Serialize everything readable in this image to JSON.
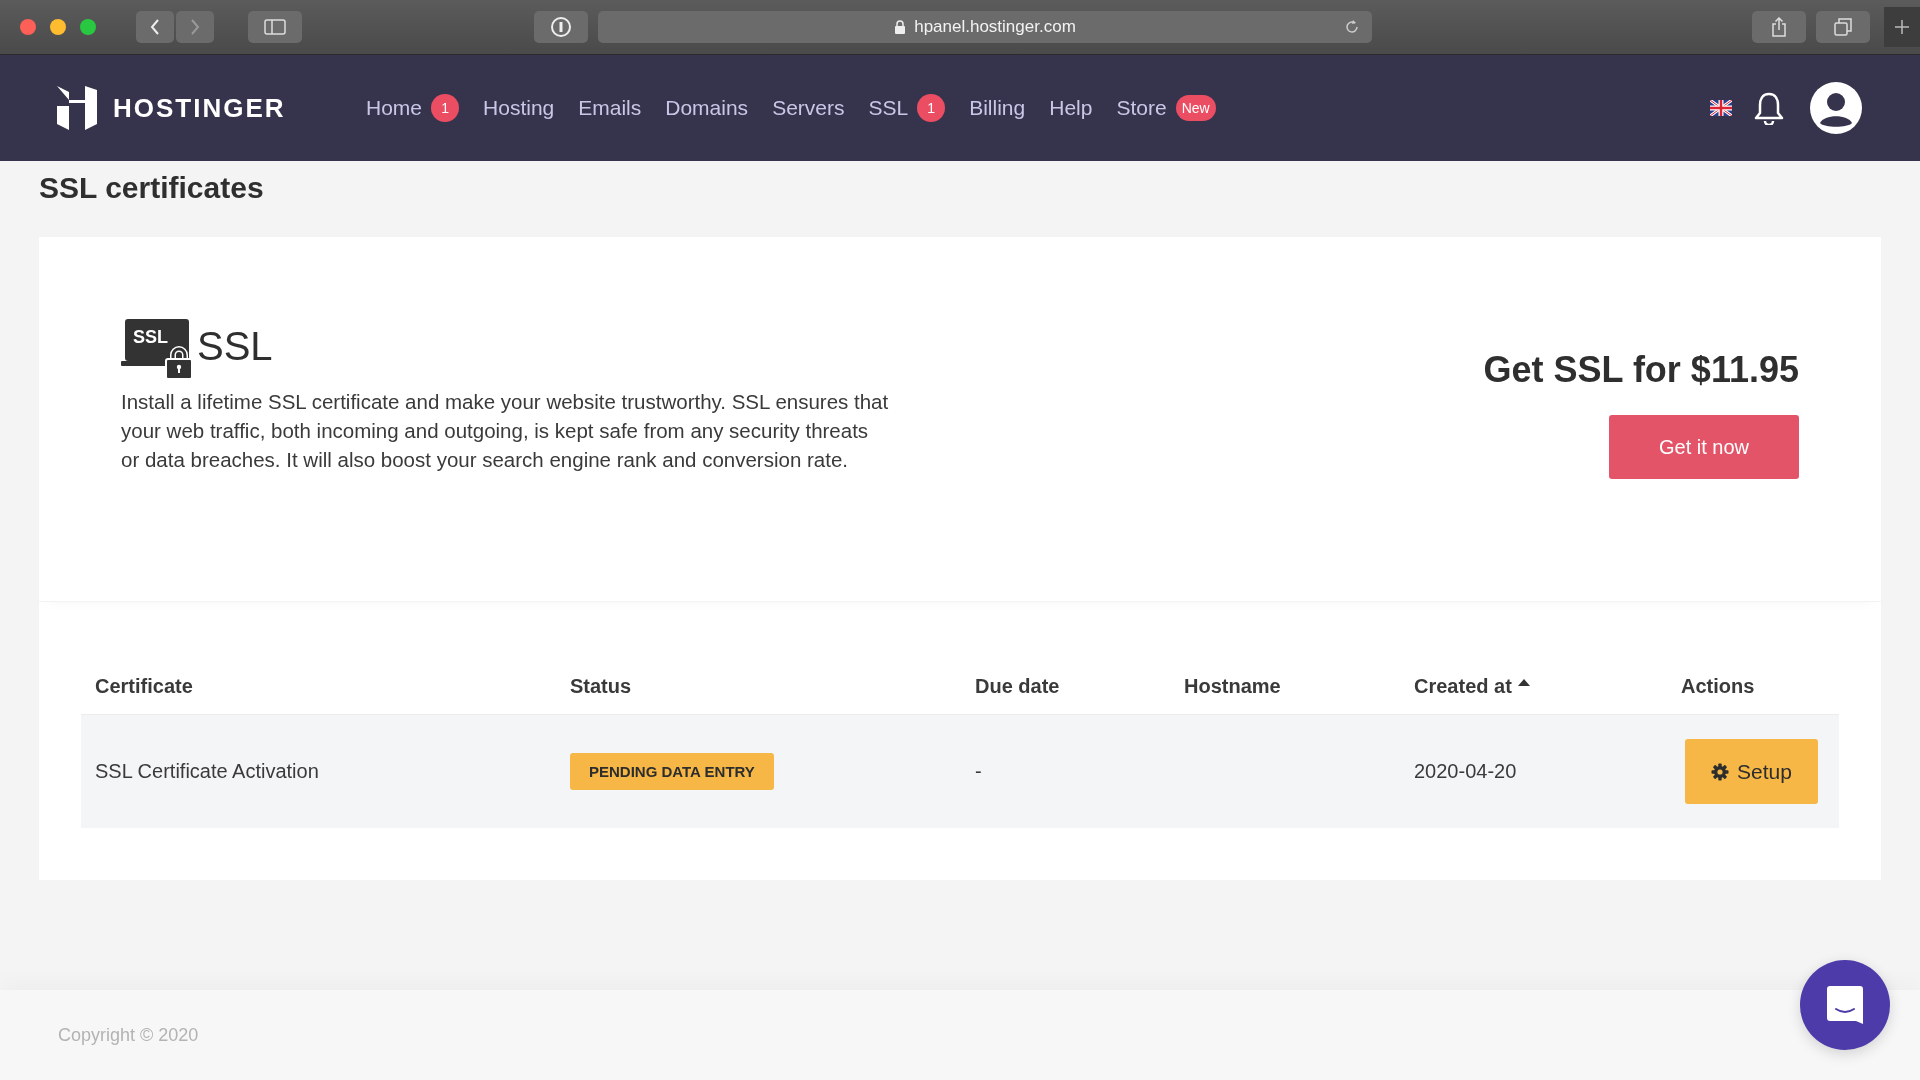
{
  "browser": {
    "url": "hpanel.hostinger.com"
  },
  "header": {
    "brand": "HOSTINGER",
    "nav": [
      {
        "label": "Home",
        "badge": "1"
      },
      {
        "label": "Hosting"
      },
      {
        "label": "Emails"
      },
      {
        "label": "Domains"
      },
      {
        "label": "Servers"
      },
      {
        "label": "SSL",
        "badge": "1"
      },
      {
        "label": "Billing"
      },
      {
        "label": "Help"
      },
      {
        "label": "Store",
        "badge": "New"
      }
    ]
  },
  "page_title": "SSL certificates",
  "promo": {
    "logo_badge": "SSL",
    "logo_text": "SSL",
    "description": "Install a lifetime SSL certificate and make your website trustworthy. SSL ensures that your web traffic, both incoming and outgoing, is kept safe from any security threats or data breaches. It will also boost your search engine rank and conversion rate.",
    "price_heading": "Get SSL for $11.95",
    "button": "Get it now"
  },
  "table": {
    "columns": [
      {
        "label": "Certificate",
        "sorted": false
      },
      {
        "label": "Status",
        "sorted": false
      },
      {
        "label": "Due date",
        "sorted": false
      },
      {
        "label": "Hostname",
        "sorted": false
      },
      {
        "label": "Created at",
        "sorted": true
      },
      {
        "label": "Actions",
        "sorted": false
      }
    ],
    "rows": [
      {
        "certificate": "SSL Certificate Activation",
        "status": "PENDING DATA ENTRY",
        "due_date": "-",
        "created_at": "2020-04-20",
        "action": "Setup"
      }
    ]
  },
  "footer": {
    "copyright": "Copyright © 2020"
  }
}
